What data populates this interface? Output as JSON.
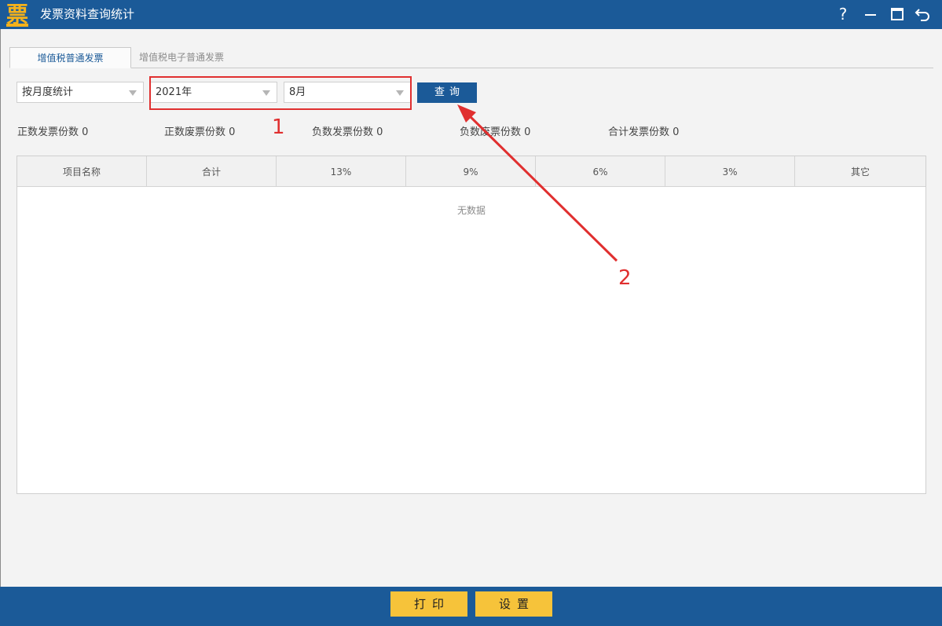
{
  "window": {
    "title": "发票资料查询统计",
    "logo_text": "票",
    "help_label": "?"
  },
  "tabs": [
    {
      "label": "增值税普通发票",
      "active": true
    },
    {
      "label": "增值税电子普通发票",
      "active": false
    }
  ],
  "filters": {
    "mode": {
      "value": "按月度统计"
    },
    "year": {
      "value": "2021年"
    },
    "month": {
      "value": "8月"
    },
    "query_label": "查询"
  },
  "stats": [
    {
      "label": "正数发票份数",
      "value": "0"
    },
    {
      "label": "正数废票份数",
      "value": "0"
    },
    {
      "label": "负数发票份数",
      "value": "0"
    },
    {
      "label": "负数废票份数",
      "value": "0"
    },
    {
      "label": "合计发票份数",
      "value": "0"
    }
  ],
  "table": {
    "columns": [
      "项目名称",
      "合计",
      "13%",
      "9%",
      "6%",
      "3%",
      "其它"
    ],
    "empty_text": "无数据"
  },
  "annotations": {
    "box_number": "1",
    "arrow_number": "2",
    "color": "#e02f2f"
  },
  "footer": {
    "print_label": "打印",
    "settings_label": "设置"
  },
  "colors": {
    "primary": "#1b5a98",
    "accent": "#f6c33a",
    "logo": "#f5b21b"
  }
}
